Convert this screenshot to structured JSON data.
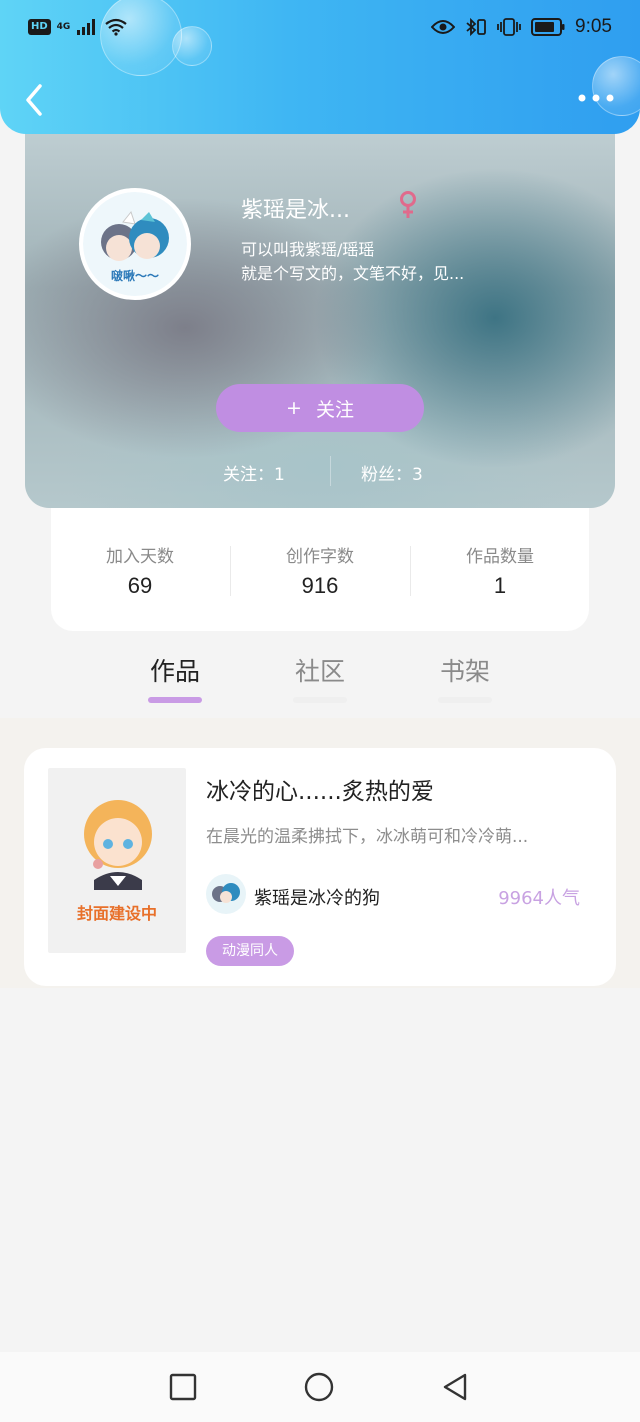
{
  "status_bar": {
    "hd": "HD",
    "network": "4G",
    "time": "9:05",
    "icons": [
      "signal-icon",
      "wifi-icon",
      "eye-icon",
      "bluetooth-icon",
      "vibrate-icon",
      "battery-icon"
    ]
  },
  "nav": {
    "back_icon": "chevron-left-icon",
    "more_icon": "more-dots-icon"
  },
  "profile": {
    "name": "紫瑶是冰...",
    "gender_icon": "female-icon",
    "bio_line1": "可以叫我紫瑶/瑶瑶",
    "bio_line2": "就是个写文的，文笔不好，见...",
    "avatar_caption": "啵啾～～",
    "follow_plus": "+",
    "follow_label": "关注",
    "following_text": "关注：1",
    "fans_text": "粉丝：3"
  },
  "stats": [
    {
      "label": "加入天数",
      "value": "69"
    },
    {
      "label": "创作字数",
      "value": "916"
    },
    {
      "label": "作品数量",
      "value": "1"
    }
  ],
  "tabs": [
    {
      "label": "作品",
      "active": true
    },
    {
      "label": "社区",
      "active": false
    },
    {
      "label": "书架",
      "active": false
    }
  ],
  "work": {
    "cover_text": "封面建设中",
    "title": "冰冷的心......炙热的爱",
    "summary": "在晨光的温柔拂拭下，冰冰萌可和冷冷萌...",
    "author": "紫瑶是冰冷的狗",
    "popularity": "9964人气",
    "tag": "动漫同人"
  },
  "colors": {
    "header_start": "#5fd4f6",
    "header_end": "#2f9ef0",
    "accent_purple": "#c08ee2",
    "tag_purple": "#c99be5",
    "popularity_purple": "#c8a2e2",
    "gender_pink": "#e06a8c"
  },
  "system_nav": [
    "square-icon",
    "circle-icon",
    "triangle-back-icon"
  ]
}
